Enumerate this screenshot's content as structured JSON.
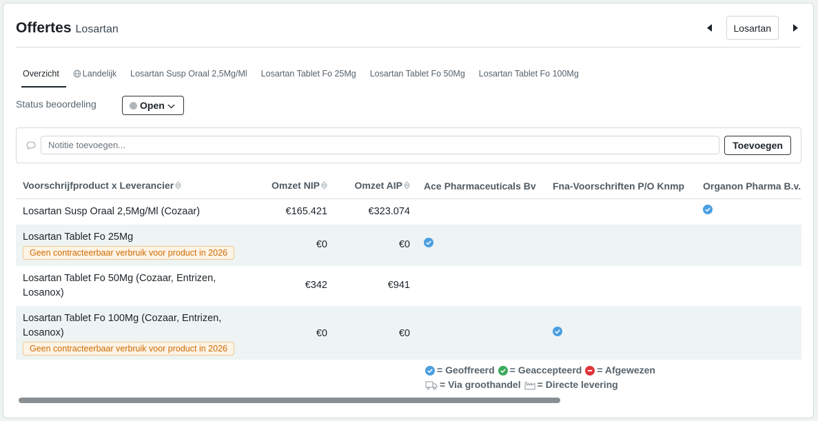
{
  "header": {
    "title": "Offertes",
    "subtitle": "Losartan",
    "product_selector": "Losartan",
    "prev_icon": "triangle-left-icon",
    "next_icon": "triangle-right-icon"
  },
  "tabs": [
    {
      "label": "Overzicht",
      "active": true
    },
    {
      "label": "Landelijk",
      "icon": "globe-icon"
    },
    {
      "label": "Losartan Susp Oraal 2,5Mg/Ml"
    },
    {
      "label": "Losartan Tablet Fo 25Mg"
    },
    {
      "label": "Losartan Tablet Fo 50Mg"
    },
    {
      "label": "Losartan Tablet Fo 100Mg"
    }
  ],
  "status": {
    "label": "Status beoordeling",
    "value": "Open",
    "dot_color": "#b0b6ba"
  },
  "note": {
    "placeholder": "Notitie toevoegen...",
    "value": "",
    "add_label": "Toevoegen",
    "icon": "speech-bubble-icon"
  },
  "table": {
    "columns": [
      "Voorschrijfproduct x Leverancier",
      "Omzet NIP",
      "Omzet AIP",
      "Ace Pharmaceuticals Bv",
      "Fna-Voorschriften P/O Knmp",
      "Organon Pharma B.v."
    ],
    "rows": [
      {
        "product": "Losartan Susp Oraal 2,5Mg/Ml (Cozaar)",
        "warning": "",
        "nip": "€165.421",
        "aip": "€323.074",
        "offers": [
          false,
          false,
          true
        ]
      },
      {
        "product": "Losartan Tablet Fo 25Mg",
        "warning": "Geen contracteerbaar verbruik voor product in 2026",
        "nip": "€0",
        "aip": "€0",
        "offers": [
          true,
          false,
          false
        ]
      },
      {
        "product": "Losartan Tablet Fo 50Mg (Cozaar, Entrizen, Losanox)",
        "warning": "",
        "nip": "€342",
        "aip": "€941",
        "offers": [
          false,
          false,
          false
        ]
      },
      {
        "product": "Losartan Tablet Fo 100Mg (Cozaar, Entrizen, Losanox)",
        "warning": "Geen contracteerbaar verbruik voor product in 2026",
        "nip": "€0",
        "aip": "€0",
        "offers": [
          false,
          true,
          false
        ]
      }
    ]
  },
  "legend": {
    "offered": "= Geoffreerd",
    "accepted": "= Geaccepteerd",
    "rejected": "= Afgewezen",
    "wholesale": "= Via groothandel",
    "direct": "= Directe levering"
  },
  "colors": {
    "offered": "#4a9fe0",
    "accepted": "#3dab5c",
    "rejected": "#e0353c",
    "warning": "#d06c00"
  }
}
